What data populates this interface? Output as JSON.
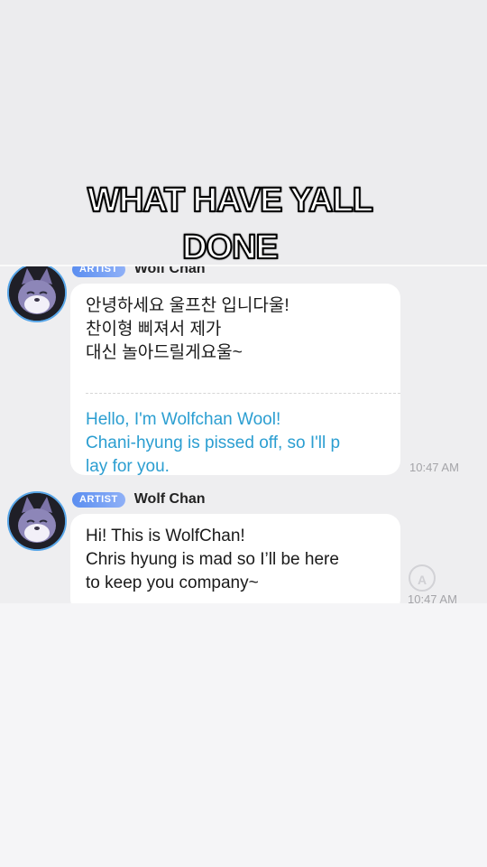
{
  "overlay": {
    "caption": "WHAT HAVE YALL DONE"
  },
  "messages": [
    {
      "badge": "ARTIST",
      "sender": "Wolf Chan",
      "original": "안녕하세요 울프찬 입니다울!\n찬이형 삐져서 제가\n대신 놀아드릴게요울~",
      "translation": "Hello, I'm Wolfchan Wool!\nChani-hyung is pissed off, so I'll p\nlay for you.",
      "time": "10:47 AM"
    },
    {
      "badge": "ARTIST",
      "sender": "Wolf Chan",
      "text": "Hi! This is WolfChan!\nChris hyung is mad so I’ll be here\nto keep you company~",
      "time": "10:47 AM",
      "translate_icon": "translate-icon"
    }
  ]
}
